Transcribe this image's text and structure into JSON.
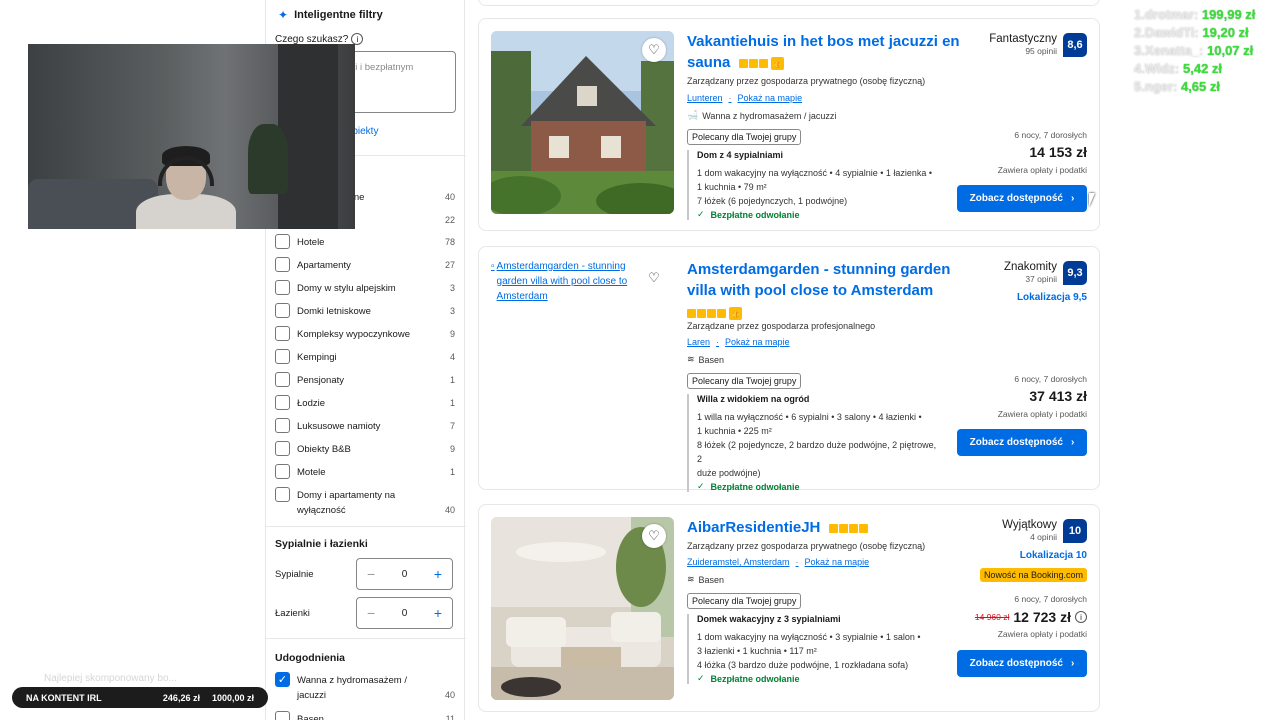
{
  "sidebar": {
    "smart_title": "Inteligentne filtry",
    "ask_label": "Czego szukasz?",
    "ask_placeholder": "m miejsca ze ami i bezpłatnym",
    "ask_link": "ż obiekty",
    "partial_rows": [
      {
        "label": "yjne",
        "count": "40"
      },
      {
        "count": "22"
      }
    ],
    "property_types": [
      {
        "label": "Hotele",
        "count": "78"
      },
      {
        "label": "Apartamenty",
        "count": "27"
      },
      {
        "label": "Domy w stylu alpejskim",
        "count": "3"
      },
      {
        "label": "Domki letniskowe",
        "count": "3"
      },
      {
        "label": "Kompleksy wypoczynkowe",
        "count": "9"
      },
      {
        "label": "Kempingi",
        "count": "4"
      },
      {
        "label": "Pensjonaty",
        "count": "1"
      },
      {
        "label": "Łodzie",
        "count": "1"
      },
      {
        "label": "Luksusowe namioty",
        "count": "7"
      },
      {
        "label": "Obiekty B&B",
        "count": "9"
      },
      {
        "label": "Motele",
        "count": "1"
      },
      {
        "label": "Domy i apartamenty na wyłączność",
        "count": "40"
      }
    ],
    "rooms_heading": "Sypialnie i łazienki",
    "bedrooms_label": "Sypialnie",
    "bedrooms_value": "0",
    "bathrooms_label": "Łazienki",
    "bathrooms_value": "0",
    "facilities_heading": "Udogodnienia",
    "facility_checked": {
      "label": "Wanna z hydromasażem / jacuzzi",
      "count": "40"
    },
    "facility_partial": {
      "label": "Basen",
      "count": "11"
    }
  },
  "listings": [
    {
      "title": "Vakantiehuis in het bos met jacuzzi en sauna",
      "host": "Zarządzany przez gospodarza prywatnego (osobę fizyczną)",
      "location": "Lunteren",
      "map_link": "Pokaż na mapie",
      "amenity": "Wanna z hydromasażem / jacuzzi",
      "tag": "Polecany dla Twojej grupy",
      "room_title": "Dom z 4 sypialniami",
      "room_details": [
        "1 dom wakacyjny na wyłączność • 4 sypialnie • 1 łazienka •",
        "1 kuchnia • 79 m²",
        "7 łóżek (6 pojedynczych, 1 podwójne)"
      ],
      "free_cancel": "Bezpłatne odwołanie",
      "rating_word": "Fantastyczny",
      "opinions": "95 opinii",
      "score": "8,6",
      "nights": "6 nocy, 7 dorosłych",
      "price": "14 153 zł",
      "taxes": "Zawiera opłaty i podatki",
      "cta": "Zobacz dostępność",
      "stars": 3
    },
    {
      "title": "Amsterdamgarden - stunning garden villa with pool close to Amsterdam",
      "image_alt": "Amsterdamgarden - stunning garden villa with pool close to Amsterdam",
      "host": "Zarządzane przez gospodarza profesjonalnego",
      "location": "Laren",
      "map_link": "Pokaż na mapie",
      "amenity": "Basen",
      "tag": "Polecany dla Twojej grupy",
      "room_title": "Willa z widokiem na ogród",
      "room_details": [
        "1 willa na wyłączność • 6 sypialni • 3 salony • 4 łazienki •",
        "1 kuchnia • 225 m²",
        "8 łóżek (2 pojedyncze, 2 bardzo duże podwójne, 2 piętrowe, 2",
        "duże podwójne)"
      ],
      "free_cancel": "Bezpłatne odwołanie",
      "rating_word": "Znakomity",
      "opinions": "37 opinii",
      "score": "9,3",
      "location_score": "Lokalizacja 9,5",
      "nights": "6 nocy, 7 dorosłych",
      "price": "37 413 zł",
      "taxes": "Zawiera opłaty i podatki",
      "cta": "Zobacz dostępność",
      "stars": 4
    },
    {
      "title": "AibarResidentieJH",
      "host": "Zarządzany przez gospodarza prywatnego (osobę fizyczną)",
      "location": "Zuideramstel, Amsterdam",
      "map_link": "Pokaż na mapie",
      "amenity": "Basen",
      "tag": "Polecany dla Twojej grupy",
      "room_title": "Domek wakacyjny z 3 sypialniami",
      "room_details": [
        "1 dom wakacyjny na wyłączność • 3 sypialnie • 1 salon •",
        "3 łazienki • 1 kuchnia • 117 m²",
        "4 łóżka (3 bardzo duże podwójne, 1 rozkładana sofa)"
      ],
      "free_cancel": "Bezpłatne odwołanie",
      "rating_word": "Wyjątkowy",
      "opinions": "4 opinii",
      "score": "10",
      "location_score": "Lokalizacja 10",
      "deal": "Nowość na Booking.com",
      "nights": "6 nocy, 7 dorosłych",
      "old_price": "14 960 zł",
      "price": "12 723 zł",
      "taxes": "Zawiera opłaty i podatki",
      "cta": "Zobacz dostępność",
      "stars": 4
    }
  ],
  "leaderboard": [
    {
      "name": "1.drotmar:",
      "amount": "199,99 zł"
    },
    {
      "name": "2.DawidTi:",
      "amount": "19,20 zł"
    },
    {
      "name": "3.Xenatta_:",
      "amount": "10,07 zł"
    },
    {
      "name": "4.Widz:",
      "amount": "5,42 zł"
    },
    {
      "name": "5.nger:",
      "amount": "4,65 zł"
    }
  ],
  "goal": {
    "label": "NA KONTENT IRL",
    "current": "246,26 zł",
    "target": "1000,00 zł",
    "faded_text": "Najlepiej skomponowany bo..."
  },
  "colors": {
    "accent": "#006ce4",
    "score_bg": "#003b95",
    "star": "#febb02",
    "free": "#008234",
    "leaderboard_amount": "#3ddc3d"
  }
}
